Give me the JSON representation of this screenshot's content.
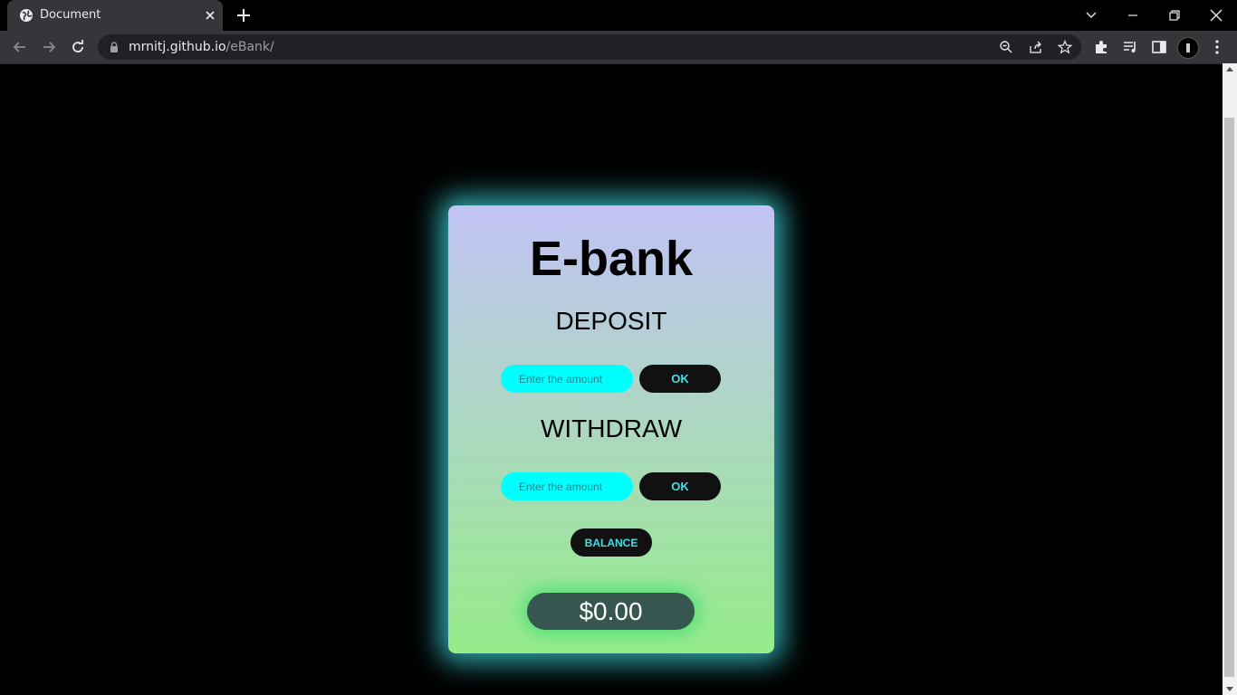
{
  "browser": {
    "tab_title": "Document",
    "url_host": "mrnitj.github.io",
    "url_path": "/eBank/"
  },
  "app": {
    "title": "E-bank",
    "deposit": {
      "heading": "DEPOSIT",
      "placeholder": "Enter the amount",
      "button_label": "OK"
    },
    "withdraw": {
      "heading": "WITHDRAW",
      "placeholder": "Enter the amount",
      "button_label": "OK"
    },
    "balance_button_label": "BALANCE",
    "balance_display": "$0.00"
  },
  "colors": {
    "card_top": "#c2c3f5",
    "card_bottom": "#96ec8a",
    "glow": "#40e0e6",
    "input_bg": "#00ffff",
    "button_bg": "#111111",
    "button_text": "#40e0e6"
  }
}
